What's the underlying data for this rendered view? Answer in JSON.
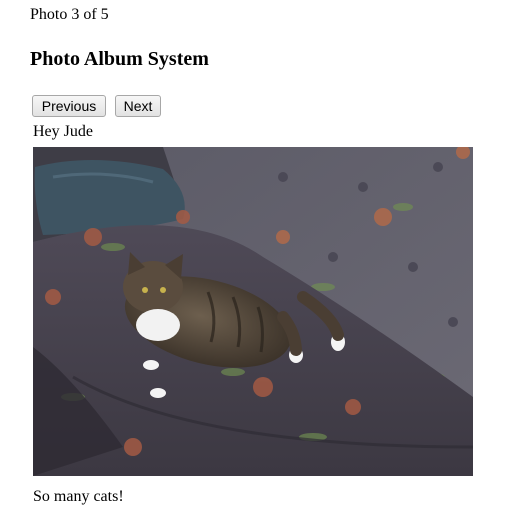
{
  "header": {
    "counter": "Photo 3 of 5",
    "title": "Photo Album System"
  },
  "nav": {
    "previous_label": "Previous",
    "next_label": "Next"
  },
  "photo": {
    "title": "Hey Jude",
    "description": "So many cats!"
  }
}
